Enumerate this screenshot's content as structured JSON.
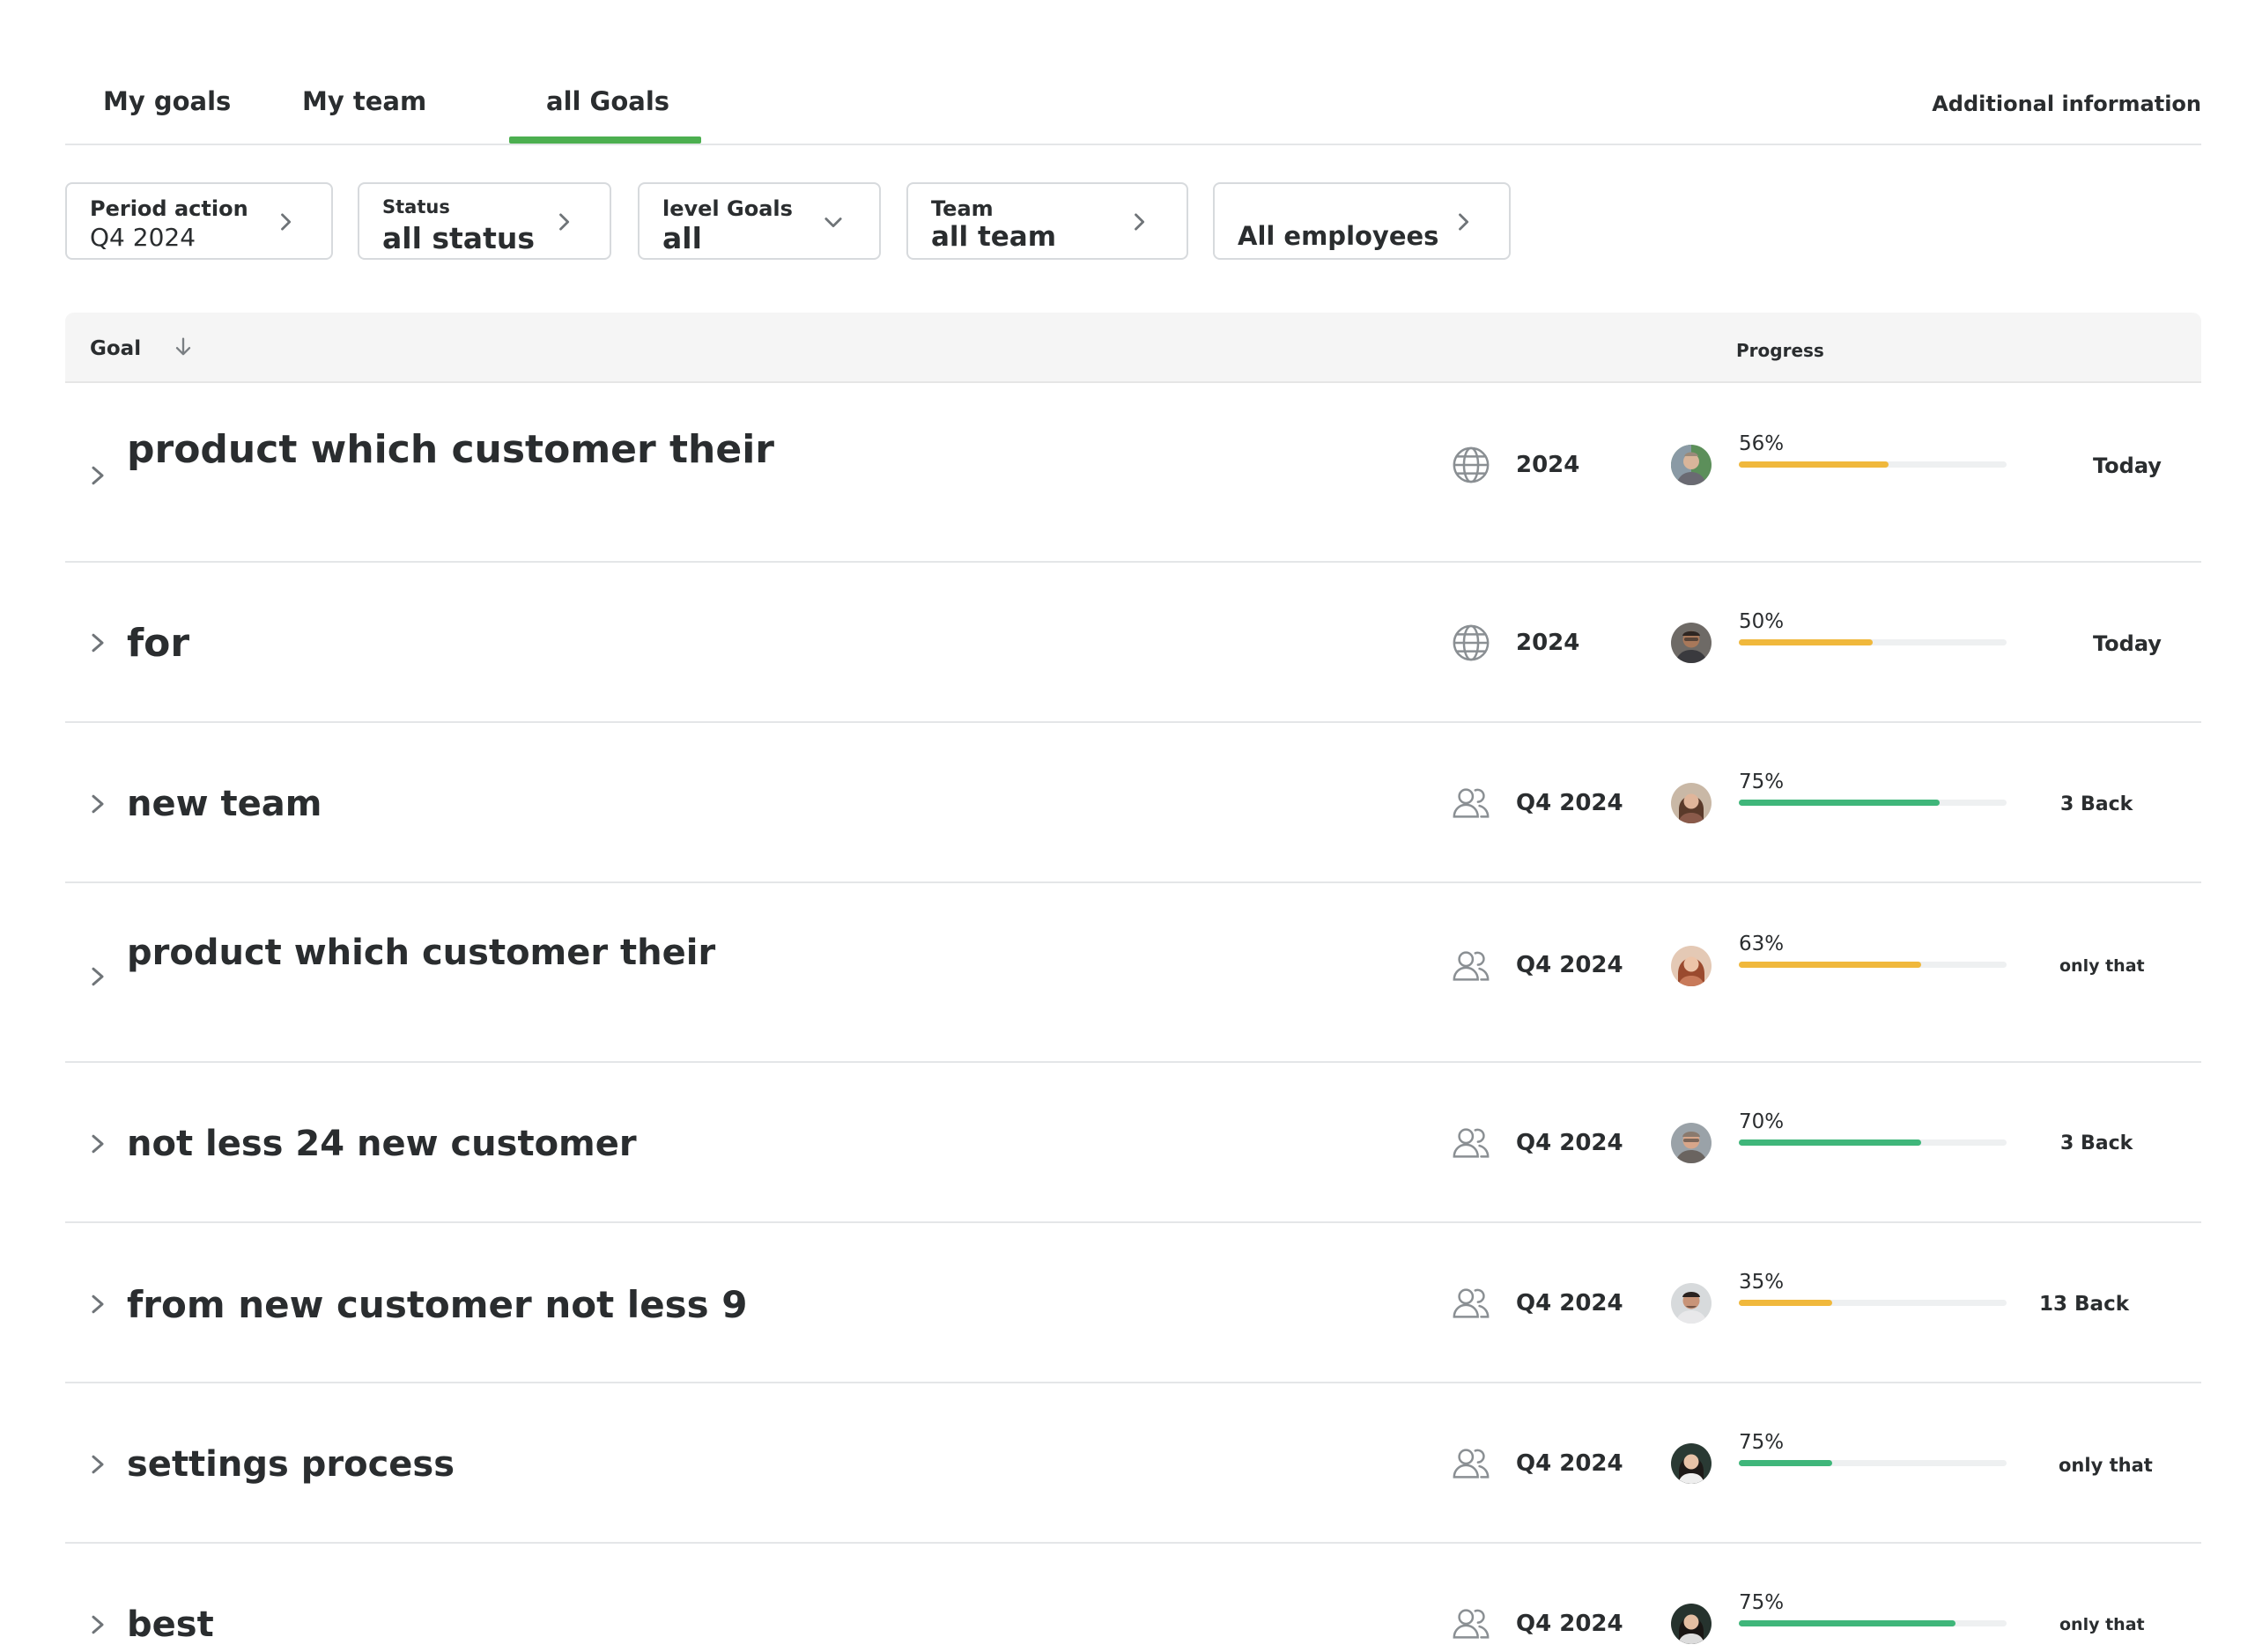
{
  "tabs": {
    "my_goals": "My goals",
    "my_team": "My team",
    "all_goals": "all Goals",
    "additional_info": "Additional information"
  },
  "filters": {
    "period": {
      "label": "Period action",
      "value": "Q4 2024"
    },
    "status": {
      "label": "Status",
      "value": "all status"
    },
    "level": {
      "label": "level Goals",
      "value": "all"
    },
    "team": {
      "label": "Team",
      "value": "all team"
    },
    "employees": {
      "value": "All employees"
    }
  },
  "table": {
    "goal_header": "Goal",
    "progress_header": "Progress",
    "rows": [
      {
        "title": "product which customer their",
        "type_icon": "globe-icon",
        "period": "2024",
        "progress_label": "56%",
        "progress": 0.56,
        "bar_color": "#f0b83c",
        "due": "Today"
      },
      {
        "title": "for",
        "type_icon": "globe-icon",
        "period": "2024",
        "progress_label": "50%",
        "progress": 0.5,
        "bar_color": "#f0b83c",
        "due": "Today"
      },
      {
        "title": "new team",
        "type_icon": "team-icon",
        "period": "Q4 2024",
        "progress_label": "75%",
        "progress": 0.75,
        "bar_color": "#3fb67a",
        "due": "3 Back"
      },
      {
        "title": "product which customer their",
        "type_icon": "team-icon",
        "period": "Q4 2024",
        "progress_label": "63%",
        "progress": 0.68,
        "bar_color": "#f0b83c",
        "due": "only that"
      },
      {
        "title": "not less 24 new customer",
        "type_icon": "team-icon",
        "period": "Q4 2024",
        "progress_label": "70%",
        "progress": 0.68,
        "bar_color": "#3fb67a",
        "due": "3 Back"
      },
      {
        "title": "from new customer not less 9",
        "type_icon": "team-icon",
        "period": "Q4 2024",
        "progress_label": "35%",
        "progress": 0.35,
        "bar_color": "#f0b83c",
        "due": "13 Back"
      },
      {
        "title": "settings process",
        "type_icon": "team-icon",
        "period": "Q4 2024",
        "progress_label": "75%",
        "progress": 0.35,
        "bar_color": "#3fb67a",
        "due": "only that"
      },
      {
        "title": "best",
        "type_icon": "team-icon",
        "period": "Q4 2024",
        "progress_label": "75%",
        "progress": 0.81,
        "bar_color": "#3fb67a",
        "due": "only that"
      }
    ]
  },
  "colors": {
    "accent_green": "#4caf50",
    "progress_yellow": "#f0b83c",
    "progress_green": "#3fb67a",
    "text": "#2a2d2f"
  }
}
